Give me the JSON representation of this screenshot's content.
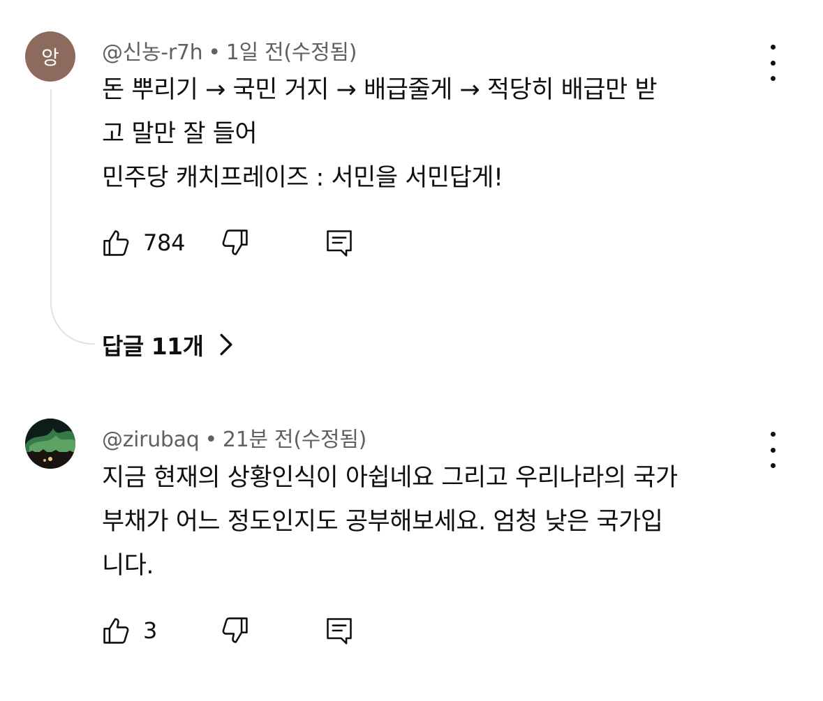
{
  "comments": [
    {
      "avatar_letter": "앙",
      "avatar_color": "#8d6a5e",
      "author": "@신농-r7h",
      "separator": "•",
      "time": "1일 전(수정됨)",
      "text": "돈 뿌리기 → 국민 거지 → 배급줄게 → 적당히 배급만 받\n고 말만 잘 들어\n민주당 캐치프레이즈 : 서민을 서민답게!",
      "likes": "784",
      "menu_icon": "more-vert-icon",
      "replies_label": "답글 11개"
    },
    {
      "avatar_image": "aurora-landscape-avatar",
      "author": "@zirubaq",
      "separator": "•",
      "time": "21분 전(수정됨)",
      "text": "지금 현재의 상황인식이 아쉽네요 그리고 우리나라의 국가\n부채가 어느 정도인지도 공부해보세요. 엄청 낮은 국가입\n니다.",
      "likes": "3",
      "menu_icon": "more-vert-icon"
    }
  ],
  "icons": {
    "like": "thumb-up-outline-icon",
    "dislike": "thumb-down-outline-icon",
    "reply": "comment-outline-icon",
    "replies_chevron": "chevron-right-icon"
  },
  "colors": {
    "text": "#0f0f0f",
    "meta": "#606060",
    "thread_line": "#e2e2e2"
  }
}
